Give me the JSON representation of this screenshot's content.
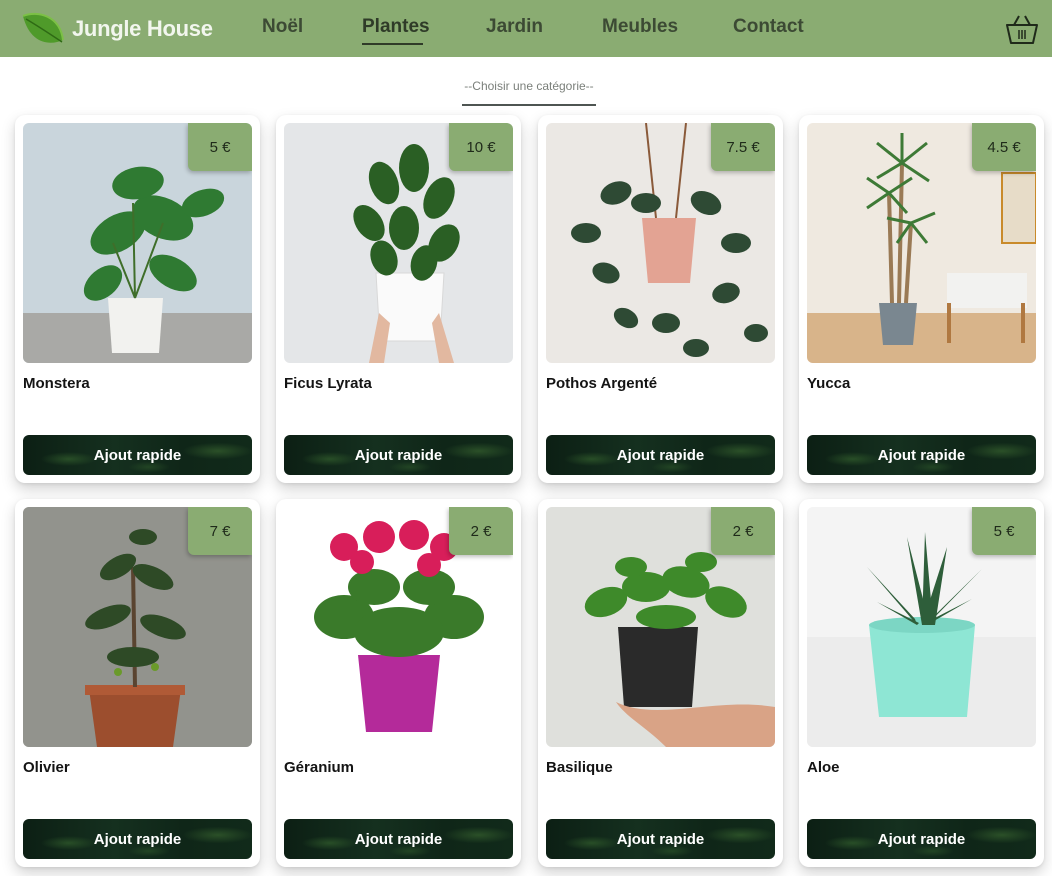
{
  "header": {
    "brand": "Jungle House",
    "nav": [
      {
        "label": "Noël",
        "active": false
      },
      {
        "label": "Plantes",
        "active": true
      },
      {
        "label": "Jardin",
        "active": false
      },
      {
        "label": "Meubles",
        "active": false
      },
      {
        "label": "Contact",
        "active": false
      }
    ],
    "cart_icon": "basket-icon",
    "logo_icon": "leaf-icon"
  },
  "filter": {
    "category_placeholder": "--Choisir une catégorie--"
  },
  "products": [
    {
      "name": "Monstera",
      "price": "5 €",
      "button": "Ajout rapide"
    },
    {
      "name": "Ficus Lyrata",
      "price": "10 €",
      "button": "Ajout rapide"
    },
    {
      "name": "Pothos Argenté",
      "price": "7.5 €",
      "button": "Ajout rapide"
    },
    {
      "name": "Yucca",
      "price": "4.5 €",
      "button": "Ajout rapide"
    },
    {
      "name": "Olivier",
      "price": "7 €",
      "button": "Ajout rapide"
    },
    {
      "name": "Géranium",
      "price": "2 €",
      "button": "Ajout rapide"
    },
    {
      "name": "Basilique",
      "price": "2 €",
      "button": "Ajout rapide"
    },
    {
      "name": "Aloe",
      "price": "5 €",
      "button": "Ajout rapide"
    }
  ],
  "colors": {
    "accent": "#8aac72",
    "nav_text": "#3c4a34",
    "button_bg": "#0f2618"
  }
}
